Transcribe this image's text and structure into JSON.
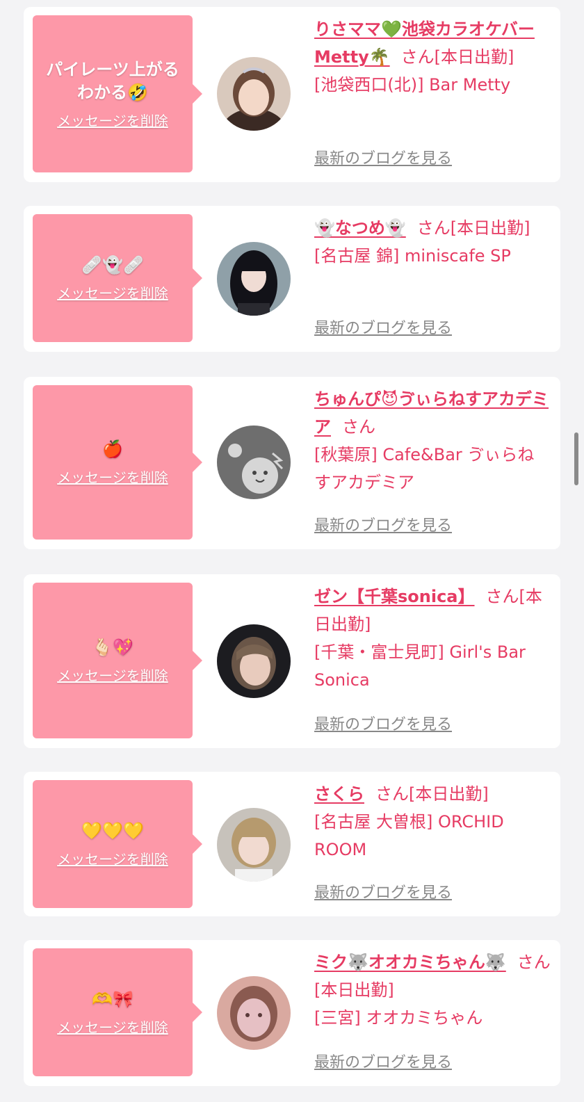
{
  "delete_label": "メッセージを削除",
  "blog_label": "最新のブログを見る",
  "colors": {
    "bubble": "#fd98a8",
    "accent": "#e63b63",
    "link_gray": "#888888",
    "background": "#f3f3f5"
  },
  "items": [
    {
      "message": "パイレーツ上がるわかる🤣",
      "name": "りさママ💚池袋カラオケバーMetty🌴",
      "suffix": "さん[本日出勤]",
      "shop": "[池袋西口(北)] Bar Metty"
    },
    {
      "message": "🩹👻🩹",
      "name": "👻なつめ👻",
      "suffix": "さん[本日出勤]",
      "shop": "[名古屋 錦] miniscafe SP"
    },
    {
      "message": "🍎",
      "name": "ちゅんぴ😈ゔぃらねすアカデミア",
      "suffix": "さん",
      "shop": "[秋葉原] Cafe&Bar ゔぃらねすアカデミア"
    },
    {
      "message": "🫰🏻💖",
      "name": "ゼン【千葉sonica】",
      "suffix": "さん[本日出勤]",
      "shop": "[千葉・富士見町] Girl's Bar Sonica"
    },
    {
      "message": "💛💛💛",
      "name": "さくら",
      "suffix": "さん[本日出勤]",
      "shop": "[名古屋 大曽根] ORCHID ROOM"
    },
    {
      "message": "🫶🎀",
      "name": "ミク🐺オオカミちゃん🐺",
      "suffix": "さん[本日出勤]",
      "shop": "[三宮] オオカミちゃん"
    }
  ]
}
